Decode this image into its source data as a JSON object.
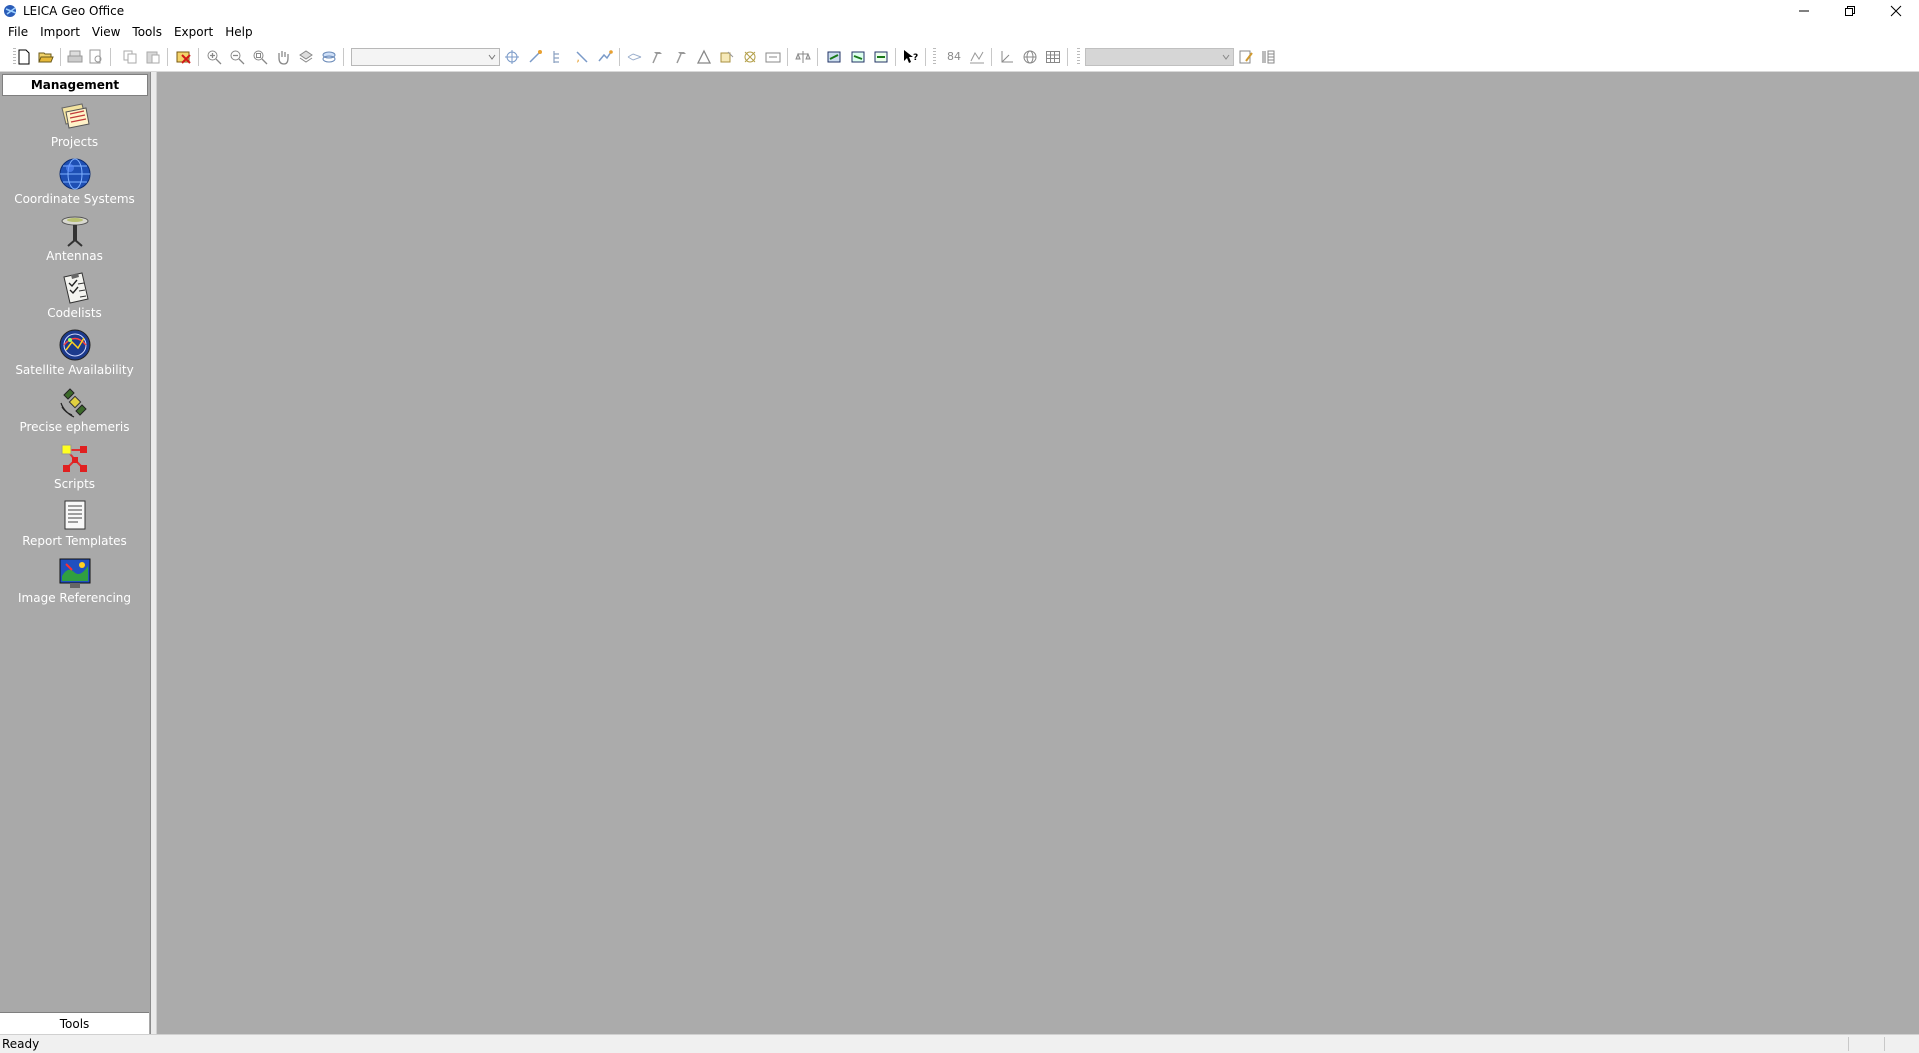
{
  "window": {
    "title": "LEICA Geo Office",
    "controls": [
      "minimize",
      "restore",
      "close"
    ]
  },
  "menu": [
    "File",
    "Import",
    "View",
    "Tools",
    "Export",
    "Help"
  ],
  "toolbar": {
    "icons": [
      "new-file-icon",
      "open-folder-icon",
      "print-icon",
      "print-preview-icon",
      "copy-icon",
      "paste-icon",
      "delete-icon",
      "zoom-in-icon",
      "zoom-out-icon",
      "zoom-window-icon",
      "pan-hand-icon",
      "zoom-fit-icon",
      "layers-icon",
      "point-icon",
      "line-icon",
      "tree-icon",
      "edit-icon",
      "process-icon",
      "tools-icon",
      "hammer-icon",
      "triangle-icon",
      "vector-icon",
      "network-icon",
      "window-icon",
      "balance-icon",
      "import-icon",
      "export-icon",
      "transfer-icon",
      "help-cursor-icon",
      "grid-number-icon",
      "axis-icon",
      "globe-icon",
      "table-icon",
      "notepad-icon",
      "columns-icon"
    ],
    "numeric_label": "84",
    "combo_1_value": "",
    "combo_2_value": ""
  },
  "left_panel": {
    "header": "Management",
    "items": [
      {
        "label": "Projects",
        "icon": "projects-icon"
      },
      {
        "label": "Coordinate Systems",
        "icon": "globe-icon"
      },
      {
        "label": "Antennas",
        "icon": "antenna-icon"
      },
      {
        "label": "Codelists",
        "icon": "clipboard-icon"
      },
      {
        "label": "Satellite Availability",
        "icon": "satellite-globe-icon"
      },
      {
        "label": "Precise ephemeris",
        "icon": "satellite-icon"
      },
      {
        "label": "Scripts",
        "icon": "scripts-icon"
      },
      {
        "label": "Report Templates",
        "icon": "report-icon"
      },
      {
        "label": "Image Referencing",
        "icon": "image-map-icon"
      }
    ],
    "footer": "Tools"
  },
  "statusbar": {
    "text": "Ready"
  },
  "colors": {
    "workspace": "#ababab",
    "panel": "#a9a9a9",
    "label": "#ffffff"
  }
}
